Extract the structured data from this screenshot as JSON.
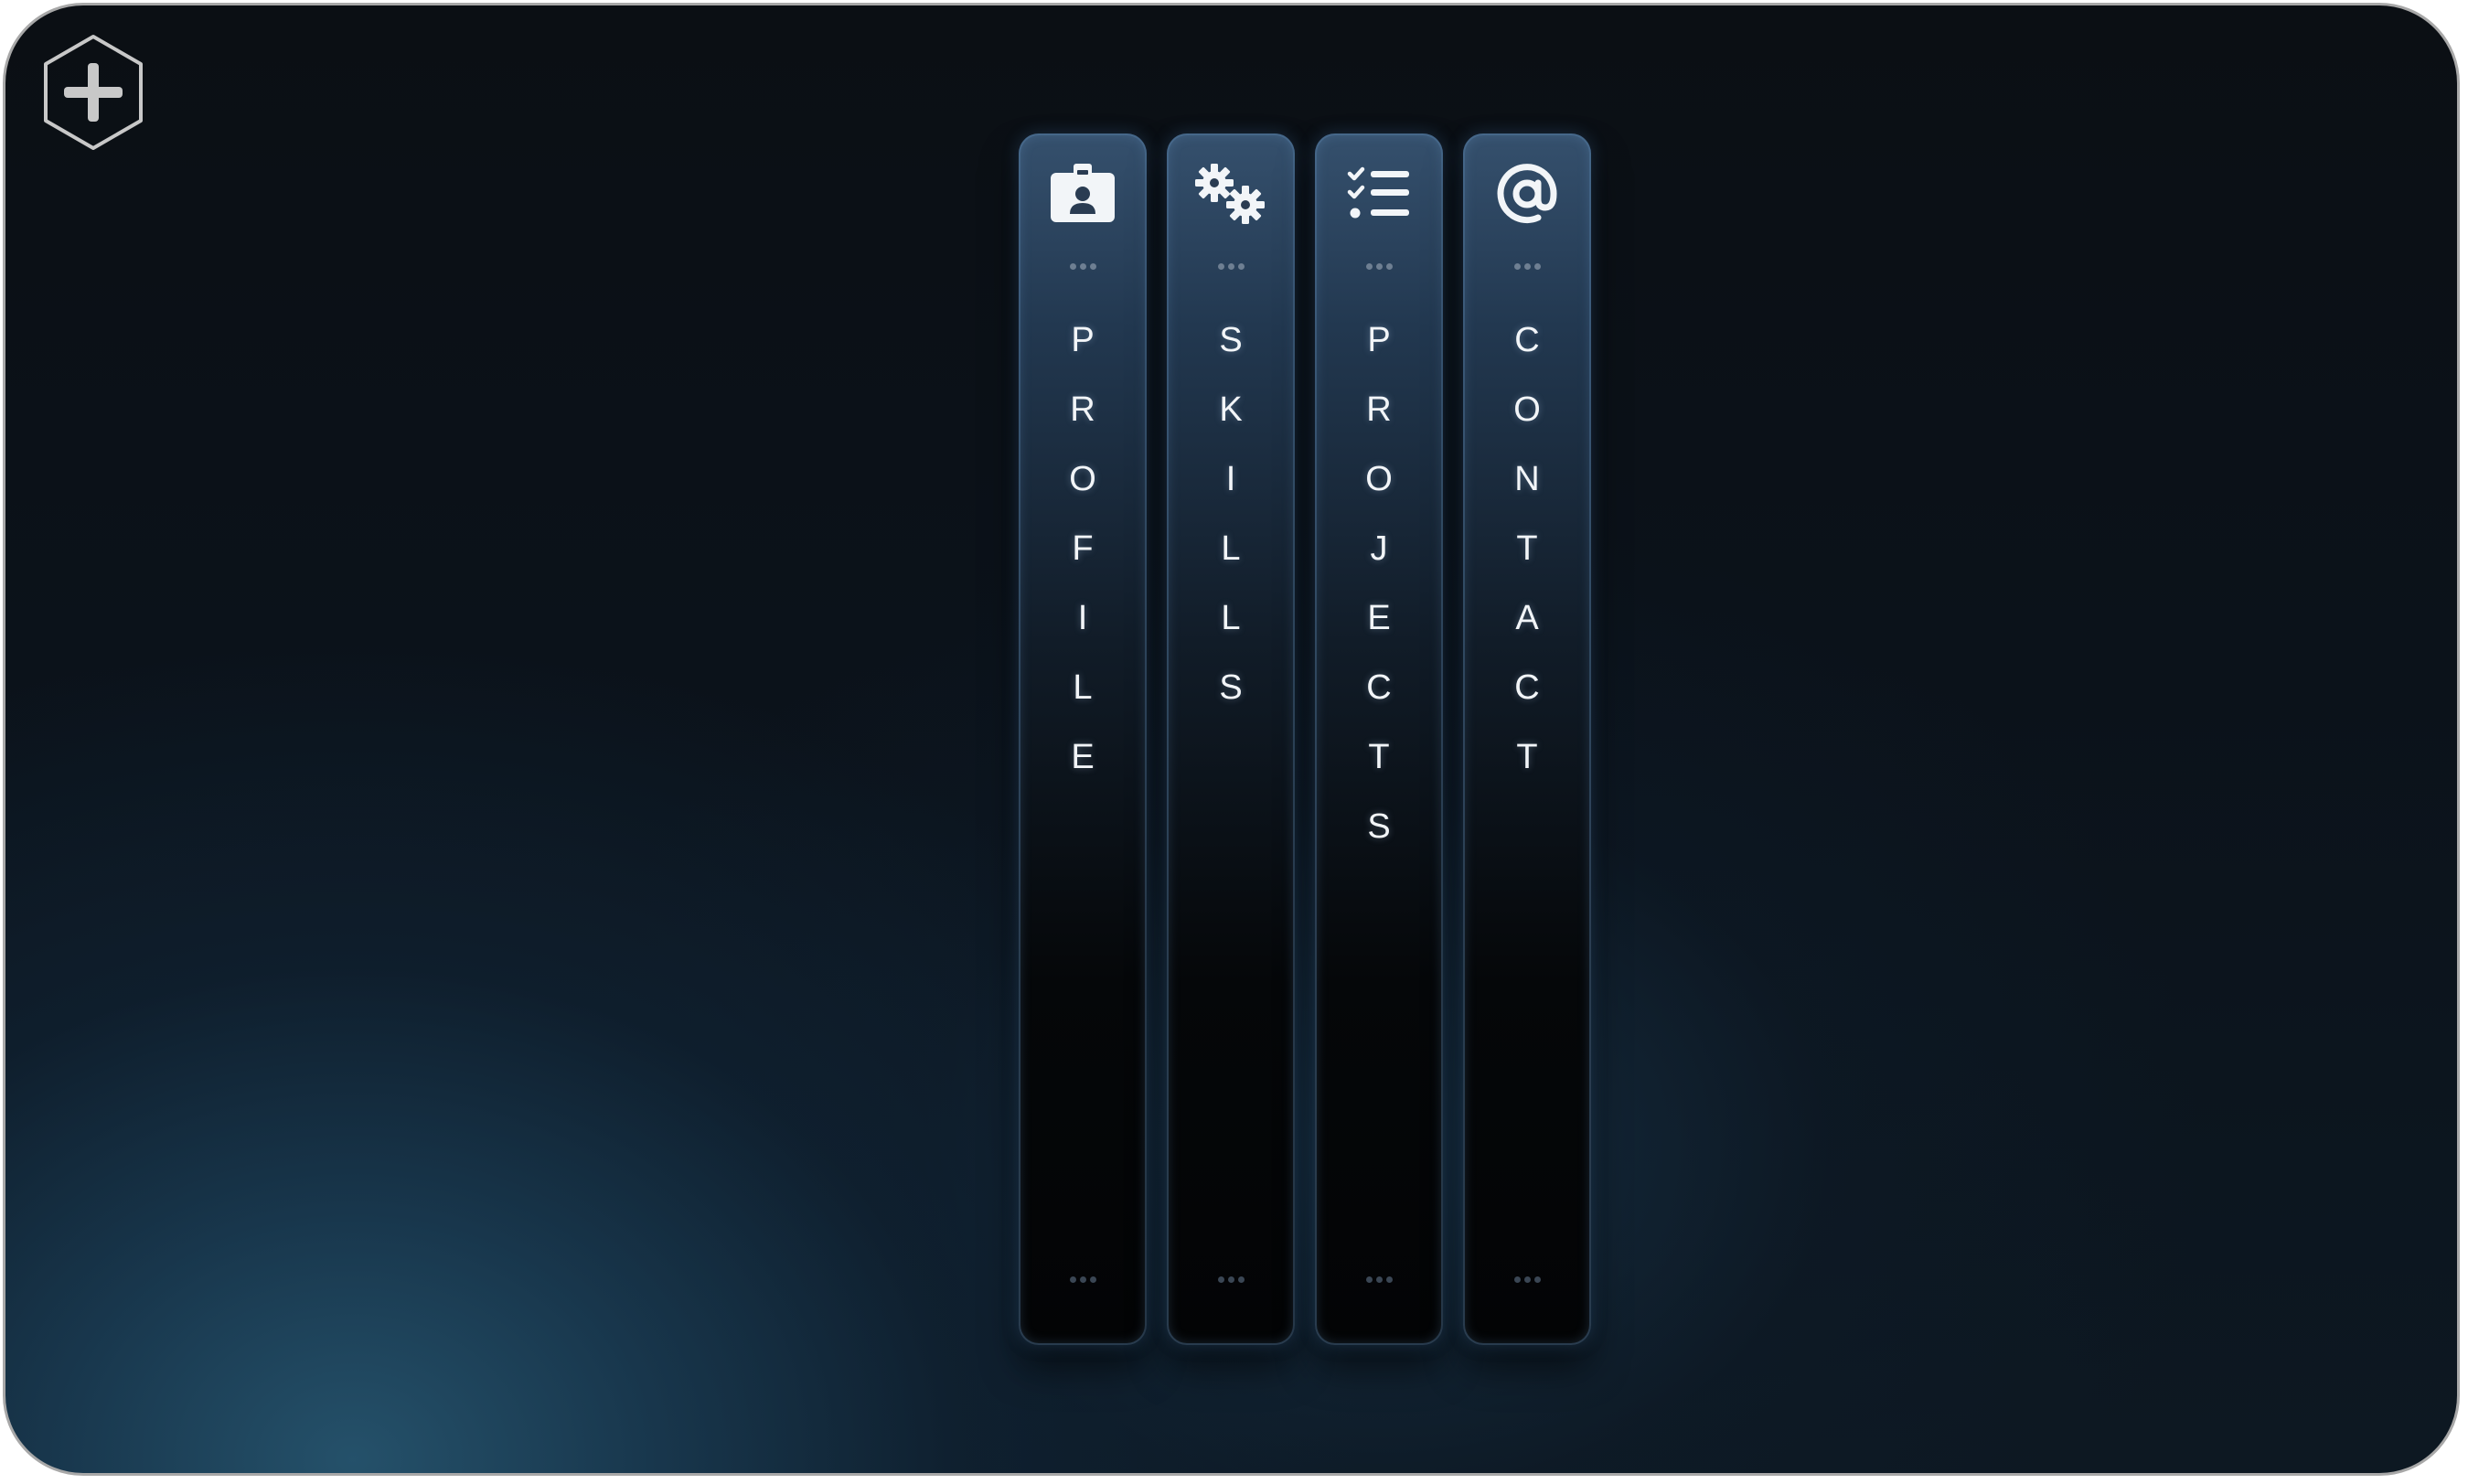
{
  "add_button": {
    "icon": "plus-hexagon-icon",
    "color": "#c8c8c8"
  },
  "columns": [
    {
      "id": "profile",
      "label": "PROFILE",
      "icon": "id-badge-icon"
    },
    {
      "id": "skills",
      "label": "SKILLS",
      "icon": "gears-icon"
    },
    {
      "id": "projects",
      "label": "PROJECTS",
      "icon": "checklist-icon"
    },
    {
      "id": "contact",
      "label": "CONTACT",
      "icon": "at-sign-icon"
    }
  ],
  "colors": {
    "icon": "#f2f5f8",
    "column_top": "#35506d",
    "column_bottom": "#030405",
    "frame_border": "#a8a8a8"
  }
}
